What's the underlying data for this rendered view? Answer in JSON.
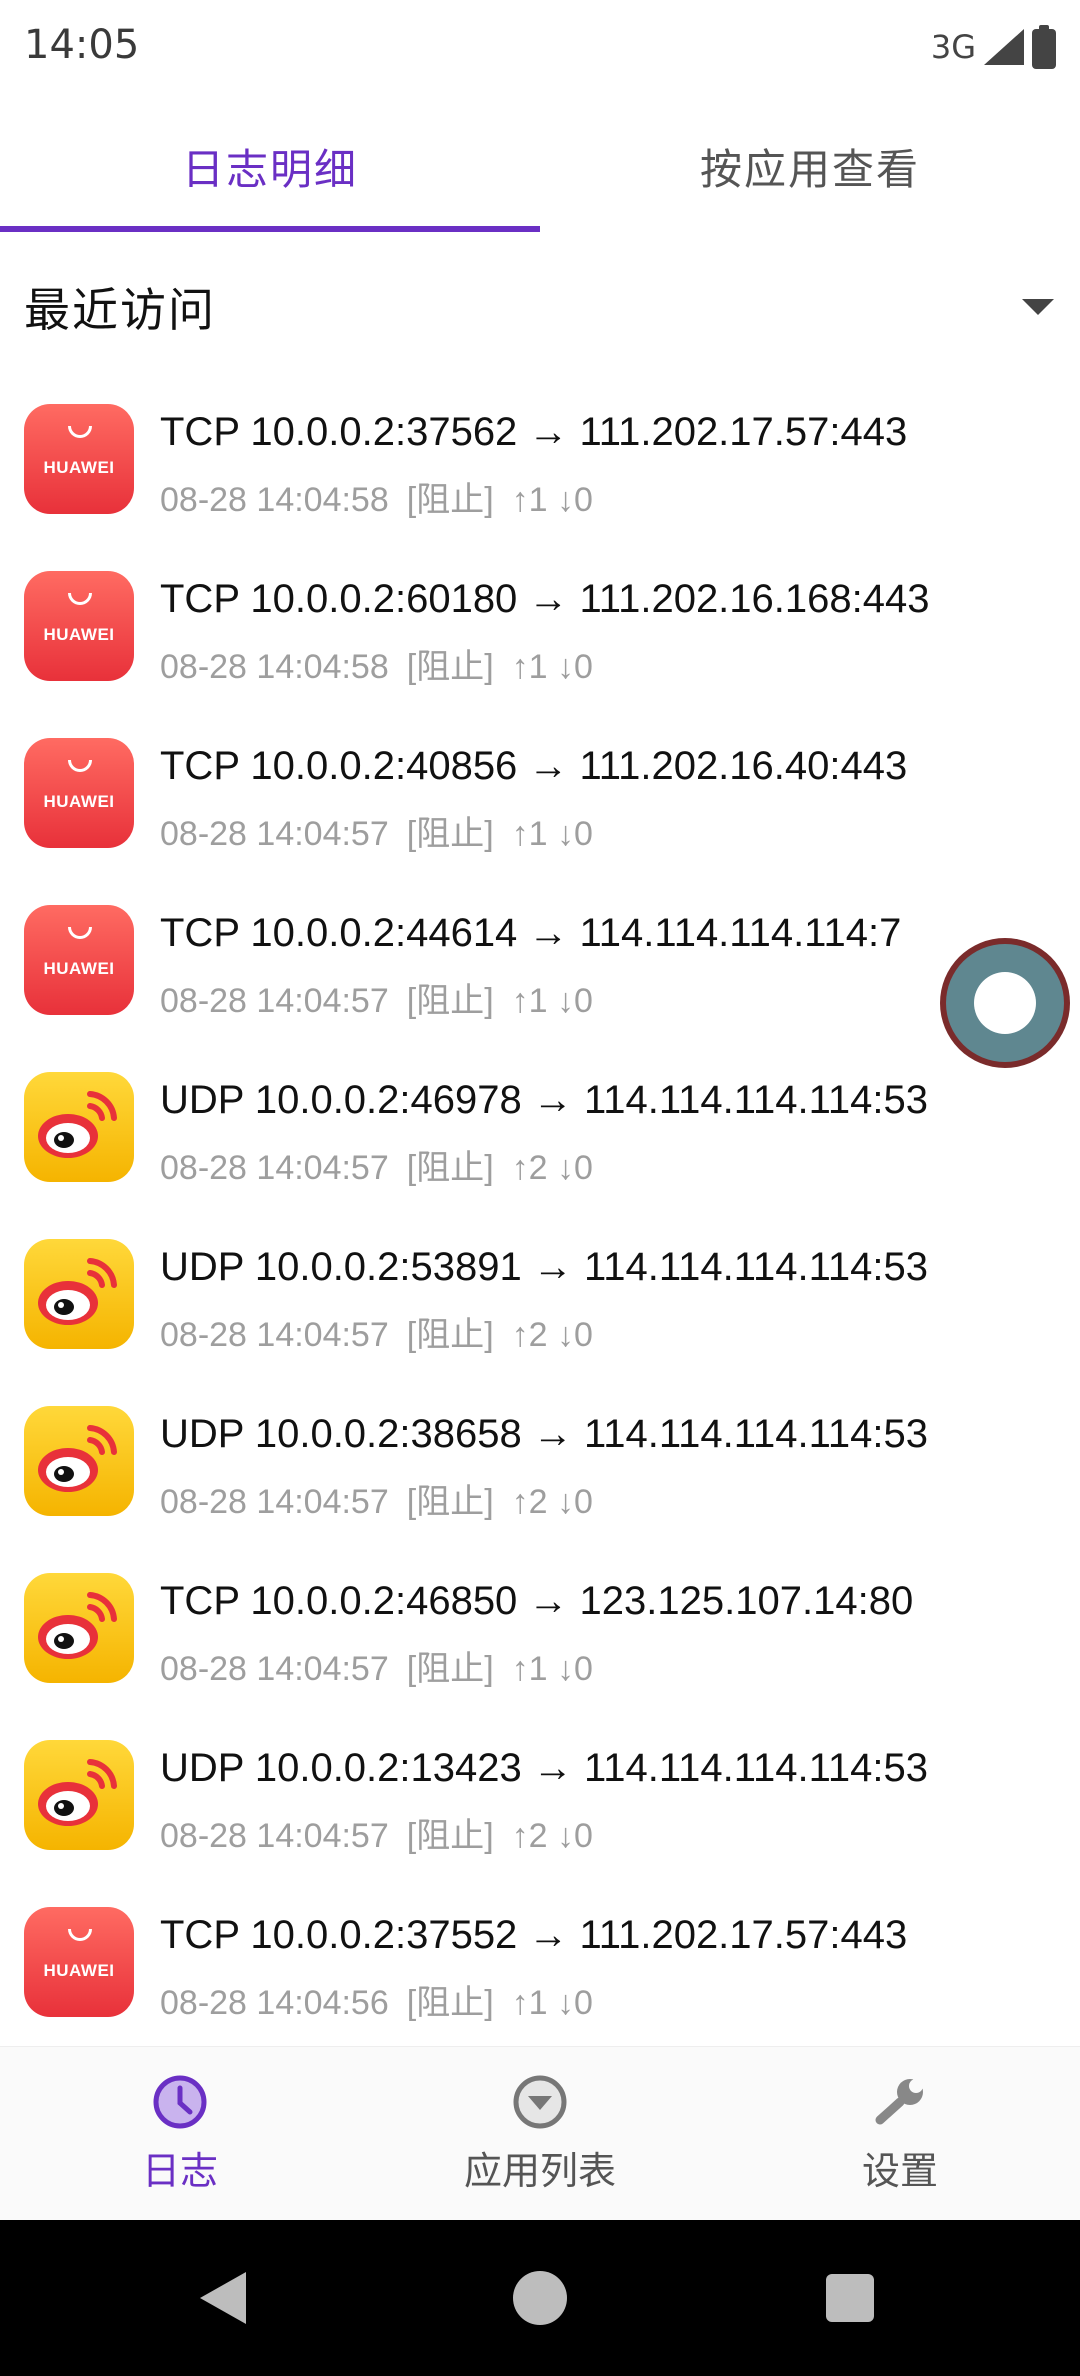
{
  "status_bar": {
    "time": "14:05",
    "network": "3G"
  },
  "tabs": [
    {
      "label": "日志明细",
      "active": true
    },
    {
      "label": "按应用查看",
      "active": false
    }
  ],
  "filter": {
    "label": "最近访问"
  },
  "logs": [
    {
      "app_icon": "huawei",
      "icon_text": "HUAWEI",
      "line": "TCP 10.0.0.2:37562 → 111.202.17.57:443",
      "time": "08-28 14:04:58",
      "status": "[阻止]",
      "traffic": "↑1 ↓0"
    },
    {
      "app_icon": "huawei",
      "icon_text": "HUAWEI",
      "line": "TCP 10.0.0.2:60180 → 111.202.16.168:443",
      "time": "08-28 14:04:58",
      "status": "[阻止]",
      "traffic": "↑1 ↓0"
    },
    {
      "app_icon": "huawei",
      "icon_text": "HUAWEI",
      "line": "TCP 10.0.0.2:40856 → 111.202.16.40:443",
      "time": "08-28 14:04:57",
      "status": "[阻止]",
      "traffic": "↑1 ↓0"
    },
    {
      "app_icon": "huawei",
      "icon_text": "HUAWEI",
      "line": "TCP 10.0.0.2:44614 → 114.114.114.114:7",
      "time": "08-28 14:04:57",
      "status": "[阻止]",
      "traffic": "↑1 ↓0"
    },
    {
      "app_icon": "weibo",
      "line": "UDP 10.0.0.2:46978 → 114.114.114.114:53",
      "time": "08-28 14:04:57",
      "status": "[阻止]",
      "traffic": "↑2 ↓0"
    },
    {
      "app_icon": "weibo",
      "line": "UDP 10.0.0.2:53891 → 114.114.114.114:53",
      "time": "08-28 14:04:57",
      "status": "[阻止]",
      "traffic": "↑2 ↓0"
    },
    {
      "app_icon": "weibo",
      "line": "UDP 10.0.0.2:38658 → 114.114.114.114:53",
      "time": "08-28 14:04:57",
      "status": "[阻止]",
      "traffic": "↑2 ↓0"
    },
    {
      "app_icon": "weibo",
      "line": "TCP 10.0.0.2:46850 → 123.125.107.14:80",
      "time": "08-28 14:04:57",
      "status": "[阻止]",
      "traffic": "↑1 ↓0"
    },
    {
      "app_icon": "weibo",
      "line": "UDP 10.0.0.2:13423 → 114.114.114.114:53",
      "time": "08-28 14:04:57",
      "status": "[阻止]",
      "traffic": "↑2 ↓0"
    },
    {
      "app_icon": "huawei",
      "icon_text": "HUAWEI",
      "line": "TCP 10.0.0.2:37552 → 111.202.17.57:443",
      "time": "08-28 14:04:56",
      "status": "[阻止]",
      "traffic": "↑1 ↓0"
    }
  ],
  "bottom_nav": [
    {
      "label": "日志",
      "icon": "clock-icon",
      "active": true
    },
    {
      "label": "应用列表",
      "icon": "filter-circle-icon",
      "active": false
    },
    {
      "label": "设置",
      "icon": "wrench-icon",
      "active": false
    }
  ],
  "colors": {
    "accent": "#6a2fc4",
    "huawei": "#e8313a",
    "weibo": "#f5b400"
  }
}
